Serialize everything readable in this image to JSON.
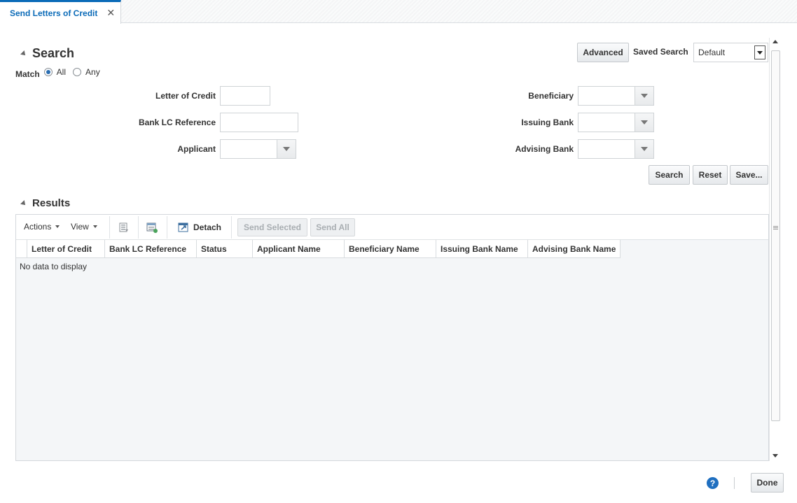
{
  "tab": {
    "label": "Send Letters of Credit",
    "close": "✕"
  },
  "search": {
    "title": "Search",
    "match_label": "Match",
    "match_options": [
      "All",
      "Any"
    ],
    "advanced_button": "Advanced",
    "saved_search_label": "Saved Search",
    "saved_search_value": "Default",
    "fields": {
      "letter_of_credit": "Letter of Credit",
      "bank_lc_reference": "Bank LC Reference",
      "applicant": "Applicant",
      "beneficiary": "Beneficiary",
      "issuing_bank": "Issuing Bank",
      "advising_bank": "Advising Bank"
    },
    "buttons": {
      "search": "Search",
      "reset": "Reset",
      "save": "Save..."
    }
  },
  "results": {
    "title": "Results",
    "toolbar": {
      "actions": "Actions",
      "view": "View",
      "detach": "Detach",
      "send_selected": "Send Selected",
      "send_all": "Send All"
    },
    "columns": [
      "Letter of Credit",
      "Bank LC Reference",
      "Status",
      "Applicant Name",
      "Beneficiary Name",
      "Issuing Bank Name",
      "Advising Bank Name"
    ],
    "empty_text": "No data to display"
  },
  "footer": {
    "done": "Done",
    "help": "?"
  }
}
